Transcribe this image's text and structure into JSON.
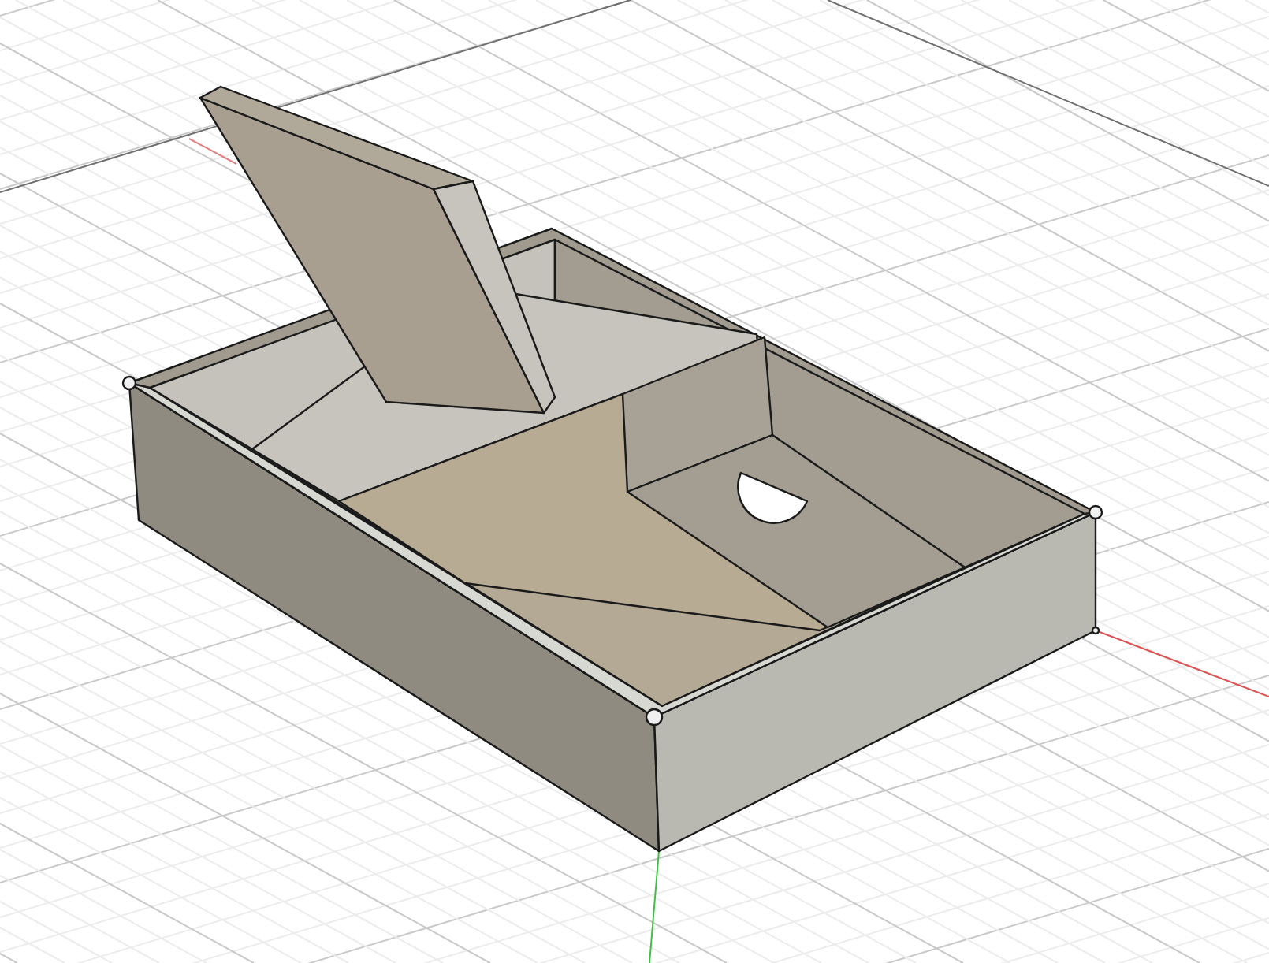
{
  "viewport": {
    "grid_visible": true,
    "axes_visible": true
  },
  "model": {
    "lid_open": true
  }
}
